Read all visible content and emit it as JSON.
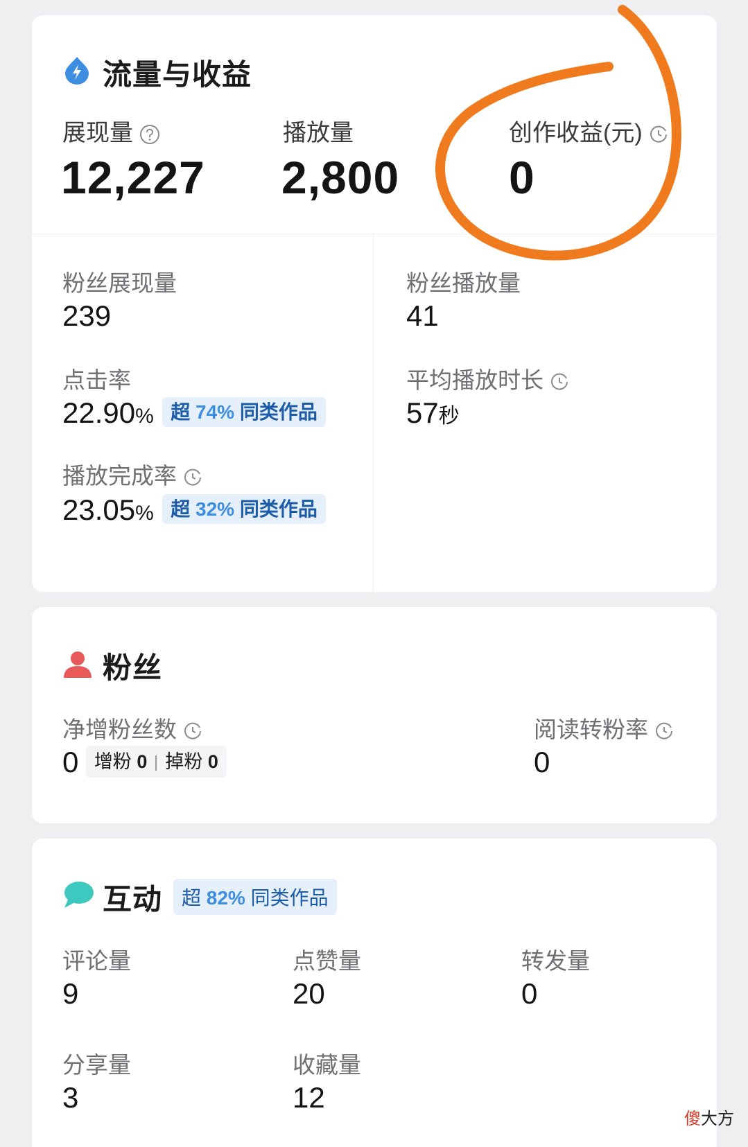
{
  "traffic": {
    "title": "流量与收益",
    "impressions": {
      "label": "展现量",
      "value": "12,227"
    },
    "plays": {
      "label": "播放量",
      "value": "2,800"
    },
    "earnings": {
      "label": "创作收益(元)",
      "value": "0"
    },
    "fan_impressions": {
      "label": "粉丝展现量",
      "value": "239"
    },
    "fan_plays": {
      "label": "粉丝播放量",
      "value": "41"
    },
    "ctr": {
      "label": "点击率",
      "value": "22.90",
      "unit": "%",
      "badge_prefix": "超 ",
      "badge_num": "74%",
      "badge_suffix": " 同类作品"
    },
    "avg_duration": {
      "label": "平均播放时长",
      "value": "57",
      "unit": "秒"
    },
    "completion": {
      "label": "播放完成率",
      "value": "23.05",
      "unit": "%",
      "badge_prefix": "超 ",
      "badge_num": "32%",
      "badge_suffix": " 同类作品"
    }
  },
  "fans": {
    "title": "粉丝",
    "net_gain": {
      "label": "净增粉丝数",
      "value": "0",
      "gain_label": "增粉",
      "gain_value": "0",
      "loss_label": "掉粉",
      "loss_value": "0"
    },
    "read_convert": {
      "label": "阅读转粉率",
      "value": "0"
    }
  },
  "interact": {
    "title": "互动",
    "badge_prefix": "超 ",
    "badge_num": "82%",
    "badge_suffix": " 同类作品",
    "comments": {
      "label": "评论量",
      "value": "9"
    },
    "likes": {
      "label": "点赞量",
      "value": "20"
    },
    "reposts": {
      "label": "转发量",
      "value": "0"
    },
    "shares": {
      "label": "分享量",
      "value": "3"
    },
    "favorites": {
      "label": "收藏量",
      "value": "12"
    }
  },
  "watermark": {
    "first": "傻",
    "rest": "大方"
  },
  "colors": {
    "accent_blue": "#3d8de0",
    "badge_bg": "#e6f0fb",
    "fan_icon": "#e85a5a",
    "chat_icon": "#3ec9c0",
    "annotation": "#f07a1e"
  }
}
